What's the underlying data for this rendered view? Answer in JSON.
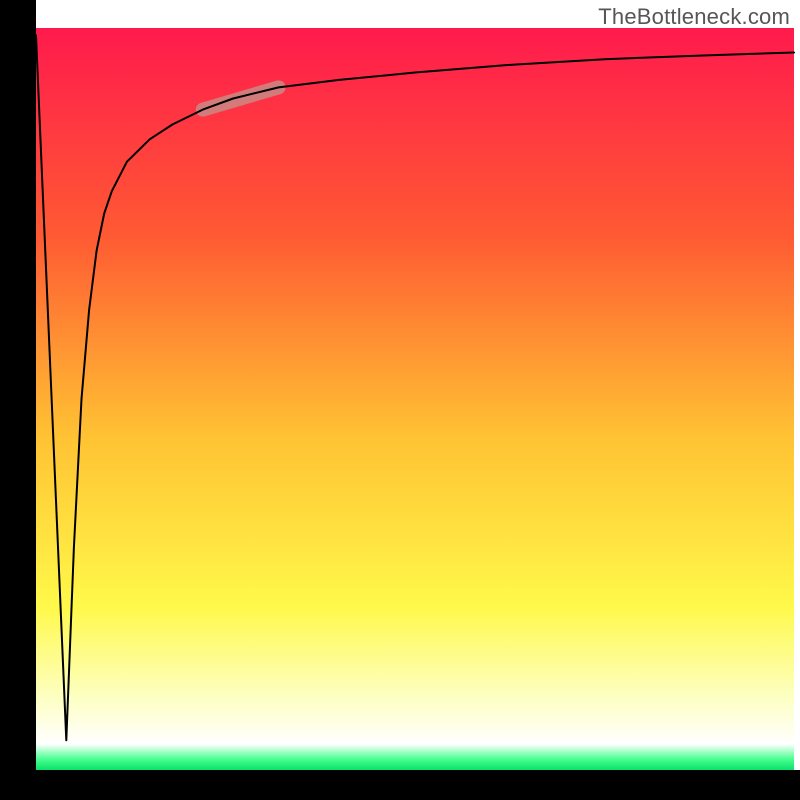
{
  "attribution": "TheBottleneck.com",
  "chart_data": {
    "type": "line",
    "title": "",
    "xlabel": "",
    "ylabel": "",
    "xlim": [
      0,
      100
    ],
    "ylim": [
      0,
      100
    ],
    "axes_visible": false,
    "grid": false,
    "legend": false,
    "background_gradient": {
      "stops": [
        {
          "pos": 0.0,
          "color": "#ff1a4d"
        },
        {
          "pos": 0.28,
          "color": "#ff5a33"
        },
        {
          "pos": 0.55,
          "color": "#ffc233"
        },
        {
          "pos": 0.78,
          "color": "#fff94a"
        },
        {
          "pos": 0.9,
          "color": "#fdffc0"
        },
        {
          "pos": 0.965,
          "color": "#ffffff"
        },
        {
          "pos": 0.985,
          "color": "#4bff91"
        },
        {
          "pos": 1.0,
          "color": "#08e26a"
        }
      ]
    },
    "frame_color": "#000000",
    "series": [
      {
        "name": "dip-curve",
        "color": "#000000",
        "stroke_width": 2,
        "x": [
          0,
          4,
          5,
          6,
          7,
          8,
          9,
          10,
          12,
          15,
          18,
          22,
          26,
          32,
          40,
          50,
          62,
          75,
          88,
          100
        ],
        "y": [
          99,
          4,
          30,
          50,
          62,
          70,
          75,
          78,
          82,
          85,
          87,
          89,
          90.5,
          92,
          93,
          94,
          95,
          95.8,
          96.3,
          96.7
        ],
        "note": "Curve starts near top-left, dives almost to the bottom around x≈4, then rises sharply and asymptotically approaches ~97 across the width."
      }
    ],
    "highlight": {
      "name": "pink-segment",
      "color": "#c98a84",
      "opacity": 0.85,
      "stroke_width": 14,
      "linecap": "round",
      "x_range": [
        22,
        32
      ],
      "y_range": [
        89,
        92
      ],
      "note": "Short thick rounded stroke overlaid on the curve in its upper-left bend."
    }
  }
}
